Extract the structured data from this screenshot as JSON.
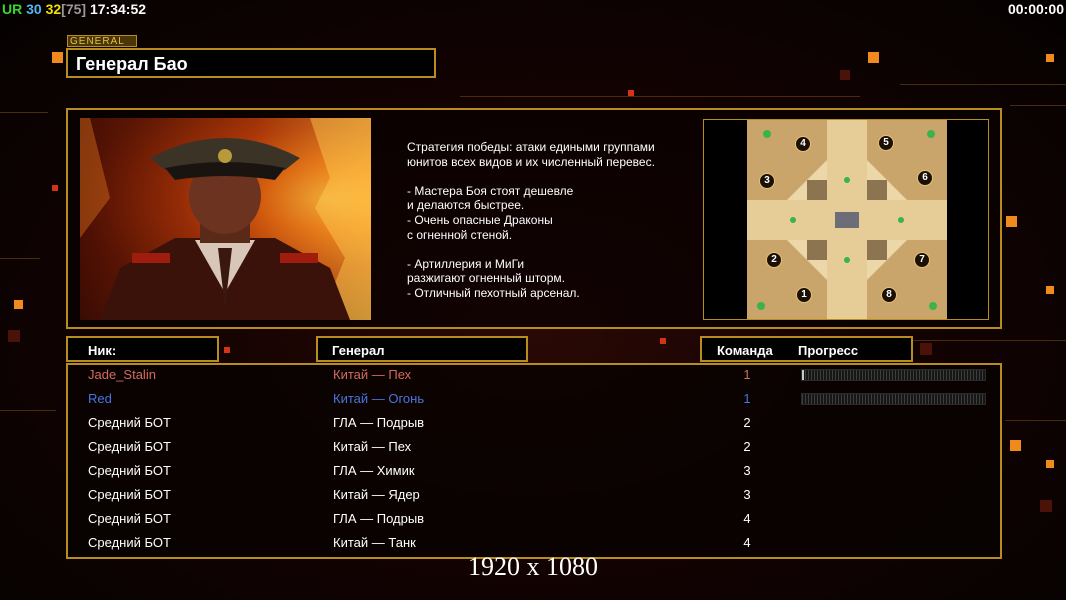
{
  "hud": {
    "ur": "UR",
    "fps": "30",
    "fps_limit": "32",
    "fps_cap": "[75]",
    "clock": "17:34:52",
    "timer": "00:00:00"
  },
  "general": {
    "section_tag": "GENERAL",
    "name": "Генерал Бао",
    "description": [
      "Стратегия победы: атаки едиными группами",
      "юнитов всех видов и их численный перевес.",
      "",
      "- Мастера Боя стоят дешевле",
      "и делаются быстрее.",
      "- Очень опасные Драконы",
      "с огненной стеной.",
      "",
      "- Артиллерия и МиГи",
      "разжигают огненный шторм.",
      "- Отличный пехотный арсенал.",
      ""
    ]
  },
  "map": {
    "positions": [
      "1",
      "2",
      "3",
      "4",
      "5",
      "6",
      "7",
      "8"
    ]
  },
  "table": {
    "headers": {
      "nick": "Ник:",
      "general": "Генерал",
      "team": "Команда",
      "progress": "Прогресс"
    }
  },
  "players": [
    {
      "nick": "Jade_Stalin",
      "general": "Китай — Пех",
      "team": "1",
      "color": "#d56a5f",
      "progress": 0.01
    },
    {
      "nick": "Red",
      "general": "Китай — Огонь",
      "team": "1",
      "color": "#4a74e0",
      "progress": 0
    },
    {
      "nick": "Средний БОТ",
      "general": "ГЛА — Подрыв",
      "team": "2"
    },
    {
      "nick": "Средний БОТ",
      "general": "Китай — Пех",
      "team": "2"
    },
    {
      "nick": "Средний БОТ",
      "general": "ГЛА — Химик",
      "team": "3"
    },
    {
      "nick": "Средний БОТ",
      "general": "Китай — Ядер",
      "team": "3"
    },
    {
      "nick": "Средний БОТ",
      "general": "ГЛА — Подрыв",
      "team": "4"
    },
    {
      "nick": "Средний БОТ",
      "general": "Китай — Танк",
      "team": "4"
    }
  ],
  "colors": {
    "frame_gold": "#b78e1e",
    "accent_orange": "#f08a1c",
    "player1_red": "#d56a5f",
    "player2_blue": "#4a74e0"
  },
  "caption": "1920 x 1080"
}
